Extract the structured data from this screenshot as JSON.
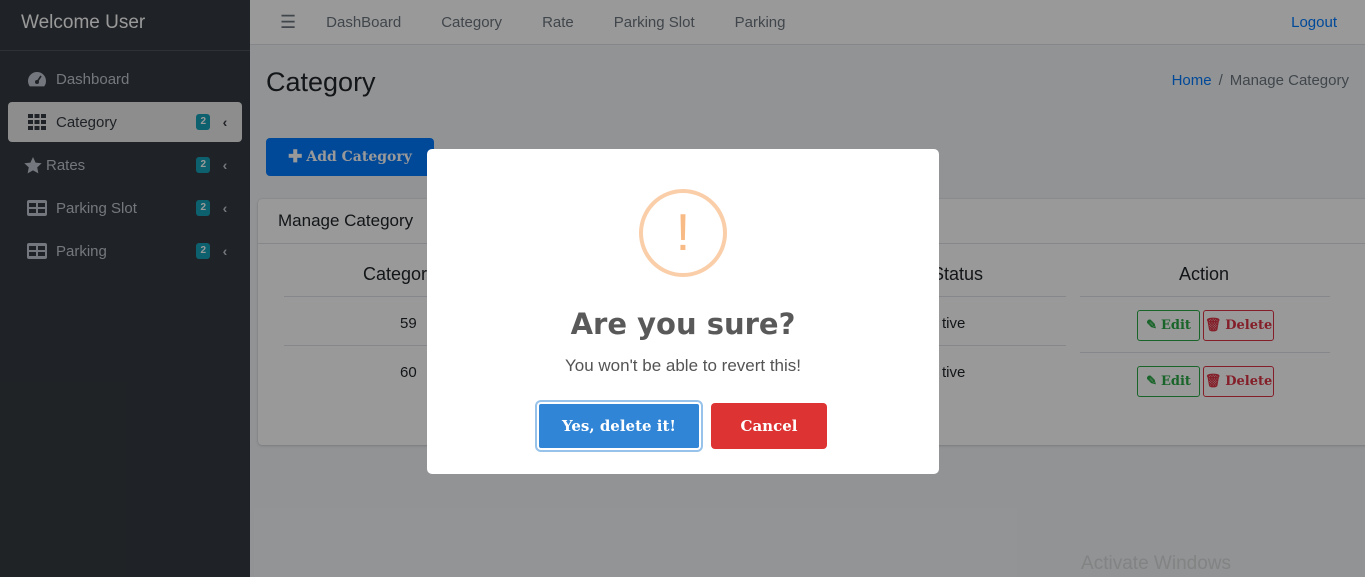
{
  "sidebar": {
    "brand": "Welcome User",
    "items": [
      {
        "label": "Dashboard",
        "icon": "dashboard-gauge-icon"
      },
      {
        "label": "Category",
        "badge": "2",
        "icon": "grid-icon"
      },
      {
        "label": "Rates",
        "badge": "2",
        "icon": "star-icon"
      },
      {
        "label": "Parking Slot",
        "badge": "2",
        "icon": "table-icon"
      },
      {
        "label": "Parking",
        "badge": "2",
        "icon": "table-icon"
      }
    ]
  },
  "topnav": {
    "links": [
      "DashBoard",
      "Category",
      "Rate",
      "Parking Slot",
      "Parking"
    ],
    "logout": "Logout"
  },
  "page": {
    "title": "Category",
    "breadcrumb_home": "Home",
    "breadcrumb_sep": "/",
    "breadcrumb_current": "Manage Category",
    "add_button": "Add Category"
  },
  "card": {
    "header": "Manage Category",
    "columns": [
      "Categor",
      "y Status",
      "Action"
    ],
    "rows": [
      {
        "id": "59",
        "status": "tive"
      },
      {
        "id": "60",
        "status": "tive"
      }
    ],
    "edit_label": "Edit",
    "delete_label": "Delete"
  },
  "dialog": {
    "icon_char": "!",
    "title": "Are you sure?",
    "text": "You won't be able to revert this!",
    "confirm": "Yes, delete it!",
    "cancel": "Cancel"
  },
  "watermark": "Activate Windows",
  "colors": {
    "sidebar_bg": "#343a40",
    "primary": "#007bff",
    "confirm": "#3085d6",
    "cancel": "#dd3333",
    "warning": "#f8bb86"
  }
}
